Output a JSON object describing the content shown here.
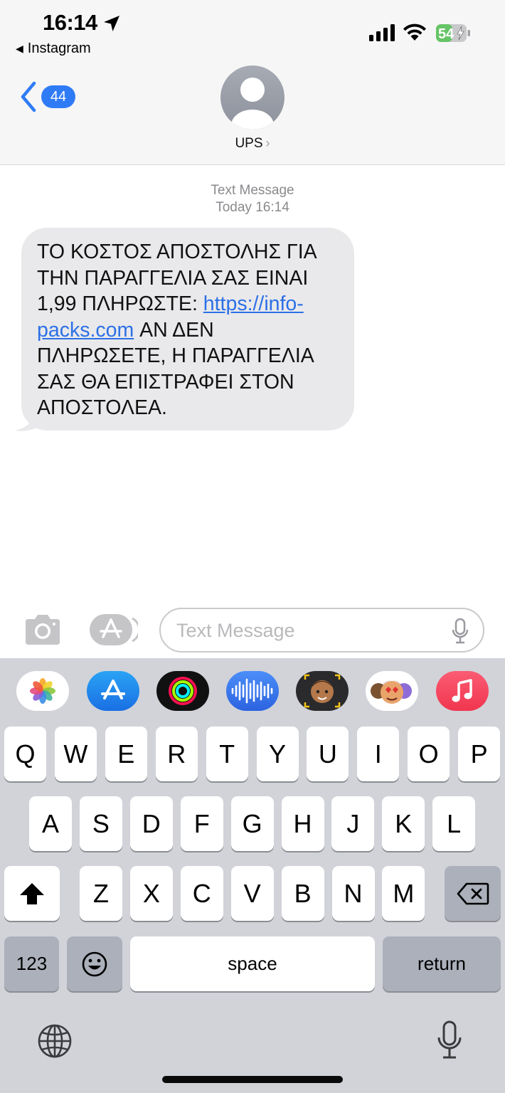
{
  "status_bar": {
    "time": "16:14",
    "back_to_app": "Instagram",
    "battery_percent": "54",
    "battery_level": 0.54,
    "charging": true,
    "signal_bars": 4
  },
  "nav": {
    "back_count": "44",
    "contact_name": "UPS"
  },
  "thread": {
    "service_label": "Text Message",
    "timestamp": "Today 16:14"
  },
  "message": {
    "text_before_link": "ΤΟ ΚΟΣΤΟΣ ΑΠΟΣΤΟΛΗΣ ΓΙΑ ΤΗΝ ΠΑΡΑΓΓΕΛΙΑ ΣΑΣ ΕΙΝΑΙ 1,99 ΠΛΗΡΩΣΤΕ: ",
    "link_text": "https://info-packs.com",
    "text_after_link": " ΑΝ ΔΕΝ ΠΛΗΡΩΣΕΤΕ, Η ΠΑΡΑΓΓΕΛΙΑ ΣΑΣ ΘΑ ΕΠΙΣΤΡΑΦΕΙ ΣΤΟΝ ΑΠΟΣΤΟΛΕΑ."
  },
  "compose": {
    "placeholder": "Text Message"
  },
  "app_drawer": [
    "photos-icon",
    "app-store-icon",
    "fitness-icon",
    "audio-message-icon",
    "memoji-camera-icon",
    "memoji-stickers-icon",
    "music-icon"
  ],
  "keyboard": {
    "row1": [
      "Q",
      "W",
      "E",
      "R",
      "T",
      "Y",
      "U",
      "I",
      "O",
      "P"
    ],
    "row2": [
      "A",
      "S",
      "D",
      "F",
      "G",
      "H",
      "J",
      "K",
      "L"
    ],
    "row3": [
      "Z",
      "X",
      "C",
      "V",
      "B",
      "N",
      "M"
    ],
    "numbers_label": "123",
    "space_label": "space",
    "return_label": "return"
  },
  "colors": {
    "accent_blue": "#2f7bf6",
    "link_blue": "#2c70e6",
    "bubble_gray": "#e9e9eb",
    "battery_green": "#65c466",
    "keyboard_bg": "#d1d3d9"
  }
}
